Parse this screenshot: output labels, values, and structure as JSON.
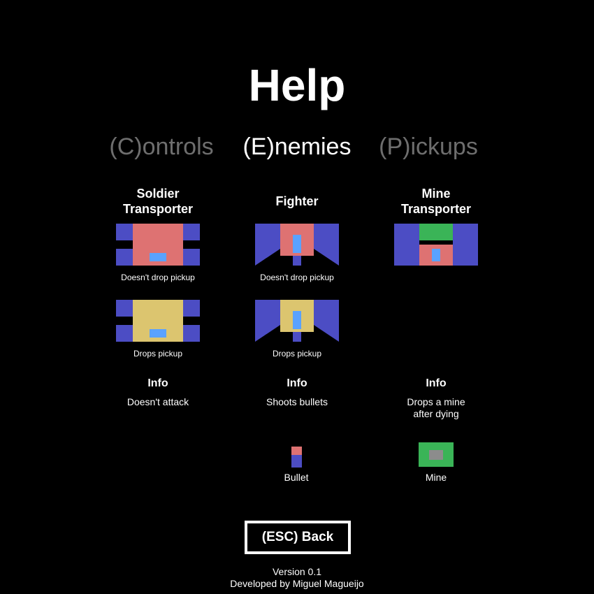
{
  "page": {
    "title": "Help"
  },
  "tabs": [
    {
      "label": "(C)ontrols",
      "active": false
    },
    {
      "label": "(E)nemies",
      "active": true
    },
    {
      "label": "(P)ickups",
      "active": false
    }
  ],
  "enemies": {
    "soldier_transporter": {
      "title_line1": "Soldier",
      "title_line2": "Transporter",
      "variant1_caption": "Doesn't drop pickup",
      "variant2_caption": "Drops pickup",
      "info_heading": "Info",
      "info_line1": "Doesn't attack"
    },
    "fighter": {
      "title": "Fighter",
      "variant1_caption": "Doesn't drop pickup",
      "variant2_caption": "Drops pickup",
      "info_heading": "Info",
      "info_line1": "Shoots bullets",
      "extra_label": "Bullet"
    },
    "mine_transporter": {
      "title_line1": "Mine",
      "title_line2": "Transporter",
      "info_heading": "Info",
      "info_line1": "Drops a mine",
      "info_line2": "after dying",
      "extra_label": "Mine"
    }
  },
  "colors": {
    "hull_no_pickup": "#de7272",
    "hull_pickup": "#dcc56f",
    "wings": "#4c4dc4",
    "cockpit": "#5aa2ff",
    "mine_green": "#3ab457",
    "mine_core": "#8c8c8c"
  },
  "back_button": {
    "label": "(ESC) Back"
  },
  "footer": {
    "version": "Version 0.1",
    "credit": "Developed by Miguel Magueijo"
  }
}
